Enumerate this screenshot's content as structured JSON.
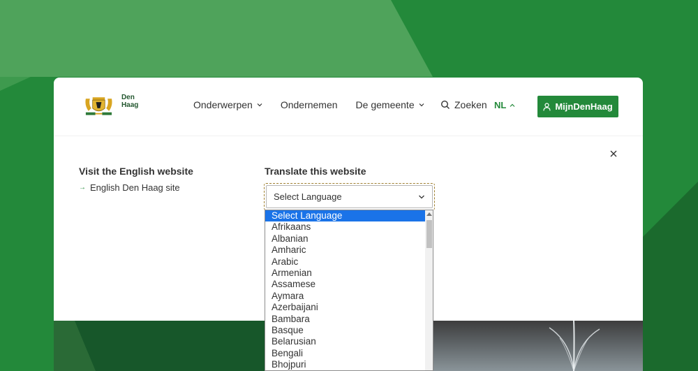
{
  "brand": {
    "logo_text": "Den Haag",
    "accent": "#23893a"
  },
  "nav": {
    "items": [
      {
        "label": "Onderwerpen",
        "has_dropdown": true
      },
      {
        "label": "Ondernemen",
        "has_dropdown": false
      },
      {
        "label": "De gemeente",
        "has_dropdown": true
      }
    ],
    "search_label": "Zoeken",
    "lang_label": "NL",
    "account_label": "MijnDenHaag"
  },
  "panel": {
    "english_title": "Visit the English website",
    "english_link": "English Den Haag site",
    "translate_title": "Translate this website",
    "select_value": "Select Language"
  },
  "dropdown": {
    "options": [
      "Select Language",
      "Afrikaans",
      "Albanian",
      "Amharic",
      "Arabic",
      "Armenian",
      "Assamese",
      "Aymara",
      "Azerbaijani",
      "Bambara",
      "Basque",
      "Belarusian",
      "Bengali",
      "Bhojpuri"
    ],
    "selected_index": 0
  }
}
